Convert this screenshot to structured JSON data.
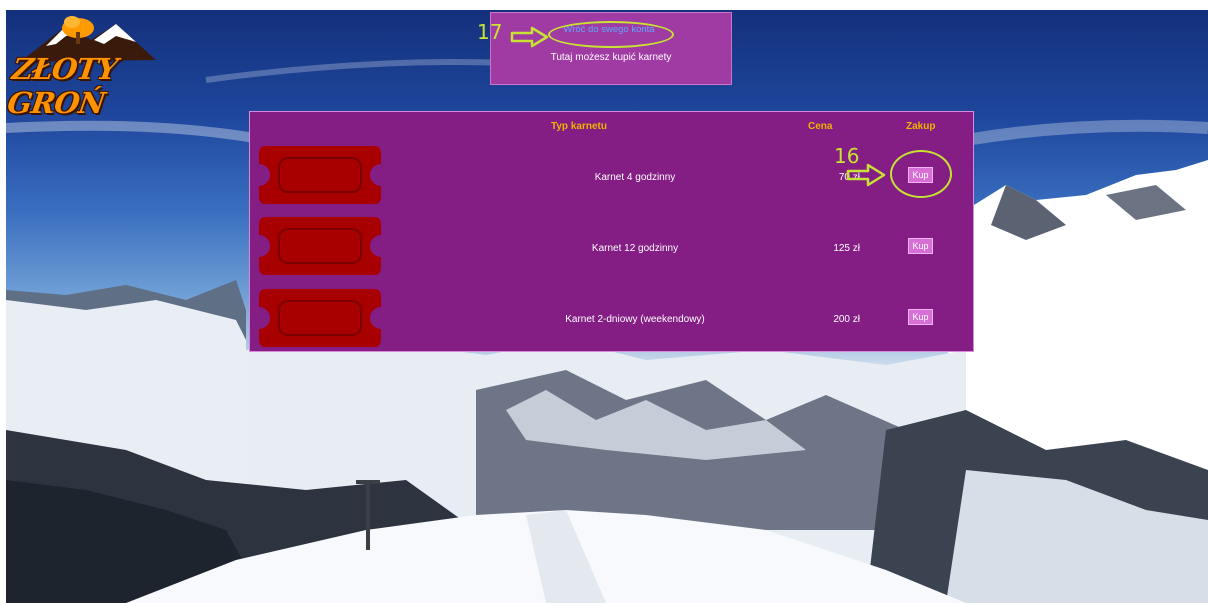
{
  "logo": {
    "text": "ZŁOTY GROŃ"
  },
  "header": {
    "back_link": "Wróć do swego konta",
    "subtitle": "Tutaj możesz kupić karnety"
  },
  "table": {
    "columns": {
      "type": "Typ karnetu",
      "price": "Cena",
      "buy": "Zakup"
    },
    "rows": [
      {
        "name": "Karnet 4 godzinny",
        "price": "70 zł",
        "buy_label": "Kup"
      },
      {
        "name": "Karnet 12 godzinny",
        "price": "125 zł",
        "buy_label": "Kup"
      },
      {
        "name": "Karnet 2-dniowy (weekendowy)",
        "price": "200 zł",
        "buy_label": "Kup"
      }
    ]
  },
  "annotations": {
    "back": "17",
    "buy": "16"
  },
  "colors": {
    "panel": "#841e84",
    "header_box": "#a03ba4",
    "ticket": "#a80000",
    "column_header": "#f2b200",
    "button": "#d76fd7",
    "annotation": "#c7e232",
    "logo": "#ff9200"
  }
}
